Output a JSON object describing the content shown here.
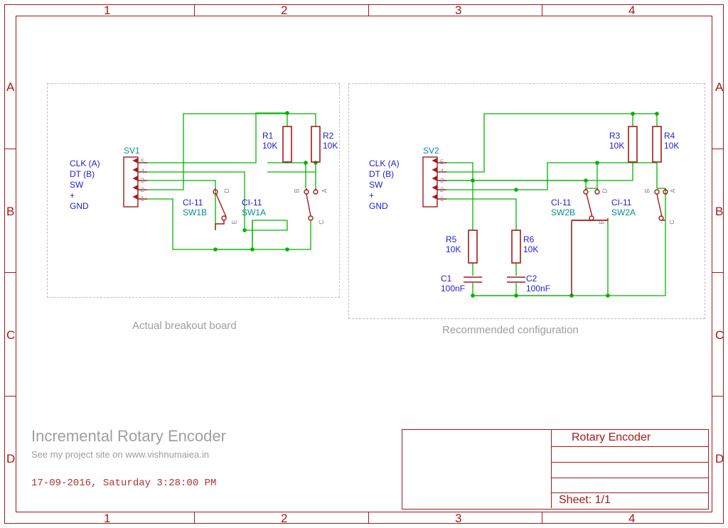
{
  "grid": {
    "cols": [
      "1",
      "2",
      "3",
      "4"
    ],
    "rows": [
      "A",
      "B",
      "C",
      "D"
    ]
  },
  "board1": {
    "connector": "SV1",
    "pins": "CLK (A)\nDT (B)\nSW\n+\nGND",
    "pin_nums": [
      "5",
      "4",
      "3",
      "2",
      "1"
    ],
    "r1_name": "R1",
    "r1_val": "10K",
    "r2_name": "R2",
    "r2_val": "10K",
    "sw1b_type": "CI-11",
    "sw1b_name": "SW1B",
    "sw1a_type": "CI-11",
    "sw1a_name": "SW1A",
    "sw1b_D": "D",
    "sw1b_E": "E",
    "sw1a_A": "A",
    "sw1a_B": "B",
    "sw1a_C": "C",
    "caption": "Actual breakout board"
  },
  "board2": {
    "connector": "SV2",
    "pins": "CLK (A)\nDT (B)\nSW\n+\nGND",
    "pin_nums": [
      "5",
      "4",
      "3",
      "2",
      "1"
    ],
    "r3_name": "R3",
    "r3_val": "10K",
    "r4_name": "R4",
    "r4_val": "10K",
    "r5_name": "R5",
    "r5_val": "10K",
    "r6_name": "R6",
    "r6_val": "10K",
    "c1_name": "C1",
    "c1_val": "100nF",
    "c2_name": "C2",
    "c2_val": "100nF",
    "sw2b_type": "CI-11",
    "sw2b_name": "SW2B",
    "sw2a_type": "CI-11",
    "sw2a_name": "SW2A",
    "sw2b_D": "D",
    "sw2b_E": "E",
    "sw2a_A": "A",
    "sw2a_B": "B",
    "sw2a_C": "C",
    "caption": "Recommended configuration"
  },
  "title": "Incremental Rotary Encoder",
  "subtitle": "See my project site on www.vishnumaiea.in",
  "datestamp": "17-09-2016, Saturday 3:28:00 PM",
  "block": {
    "name": "Rotary Encoder",
    "sheet": "Sheet: 1/1"
  }
}
